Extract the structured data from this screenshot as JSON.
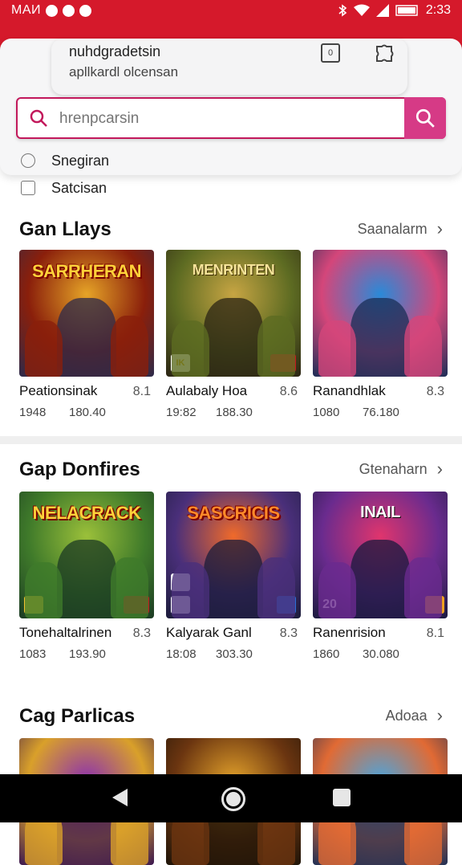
{
  "status_bar": {
    "left_text": "MAИ",
    "time": "2:33"
  },
  "browser": {
    "tab_title": "nuhdgradetsin",
    "tab_subtitle": "apllkardl olcensan",
    "tab_icon_label": "0",
    "search_placeholder": "hrenpcarsin",
    "suggestions": [
      "Snegiran",
      "Satcisan"
    ]
  },
  "sections": [
    {
      "title": "Gan Llays",
      "see_all": "Saanalarm",
      "cards": [
        {
          "name": "Peationsinak",
          "rating": "8.1",
          "stat1": "1948",
          "stat2": "180.40",
          "art_title": "SARRHERAN",
          "palette": [
            "#e6a427",
            "#8a1f0b",
            "#2c2a4a"
          ]
        },
        {
          "name": "Aulabaly Hoa",
          "rating": "8.6",
          "stat1": "19:82",
          "stat2": "188.30",
          "art_title": "MENRINTEN",
          "palette": [
            "#c7a543",
            "#5d6b22",
            "#2b2414"
          ]
        },
        {
          "name": "Ranandhlak",
          "rating": "8.3",
          "stat1": "1080",
          "stat2": "76.180",
          "art_title": "",
          "palette": [
            "#2a8ad8",
            "#d4467a",
            "#1a2d56"
          ]
        }
      ]
    },
    {
      "title": "Gap Donfires",
      "see_all": "Gtenaharn",
      "cards": [
        {
          "name": "Tonehaltalrinen",
          "rating": "8.3",
          "stat1": "1083",
          "stat2": "193.90",
          "art_title": "NELACRACK",
          "palette": [
            "#9bc03a",
            "#3f7a2a",
            "#1b3a23"
          ]
        },
        {
          "name": "Kalyarak Ganl",
          "rating": "8.3",
          "stat1": "18:08",
          "stat2": "303.30",
          "art_title": "SASCRICIS",
          "palette": [
            "#f06a2a",
            "#4a2f7a",
            "#1b1c3a"
          ]
        },
        {
          "name": "Ranenrision",
          "rating": "8.1",
          "stat1": "1860",
          "stat2": "30.080",
          "art_title": "INAIL",
          "palette": [
            "#e0356d",
            "#6a2b8e",
            "#1a1a3e"
          ]
        }
      ]
    },
    {
      "title": "Cag Parlicas",
      "see_all": "Adoaa",
      "cards": [
        {
          "palette": [
            "#8b2fb2",
            "#d9a02a",
            "#3a1650"
          ]
        },
        {
          "palette": [
            "#e3a22b",
            "#6b3510",
            "#1e1408"
          ]
        },
        {
          "palette": [
            "#49a6e0",
            "#e16a34",
            "#1e2f55"
          ]
        }
      ]
    }
  ],
  "badge_texts": [
    "IK",
    "20"
  ]
}
